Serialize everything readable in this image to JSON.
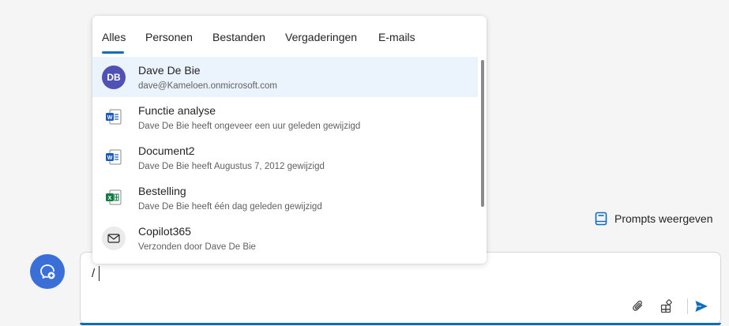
{
  "tabs": [
    {
      "label": "Alles"
    },
    {
      "label": "Personen"
    },
    {
      "label": "Bestanden"
    },
    {
      "label": "Vergaderingen"
    },
    {
      "label": "E-mails"
    }
  ],
  "results": [
    {
      "type": "person",
      "initials": "DB",
      "title": "Dave De Bie",
      "subtitle": "dave@Kameloen.onmicrosoft.com",
      "icon": "avatar"
    },
    {
      "type": "file",
      "title": "Functie analyse",
      "subtitle": "Dave De Bie heeft ongeveer een uur geleden gewijzigd",
      "icon": "word-icon"
    },
    {
      "type": "file",
      "title": "Document2",
      "subtitle": "Dave De Bie heeft Augustus 7, 2012 gewijzigd",
      "icon": "word-icon"
    },
    {
      "type": "file",
      "title": "Bestelling",
      "subtitle": "Dave De Bie heeft één dag geleden gewijzigd",
      "icon": "excel-icon"
    },
    {
      "type": "email",
      "title": "Copilot365",
      "subtitle": "Verzonden door Dave De Bie",
      "icon": "mail-icon"
    }
  ],
  "prompts": {
    "label": "Prompts weergeven",
    "icon": "prompts-book-icon"
  },
  "composer": {
    "value": "/"
  },
  "colors": {
    "accent": "#0f6cbd",
    "avatar": "#4f52b2",
    "word": "#185abd",
    "excel": "#107c41",
    "send": "#0f6cbd",
    "copilot": "#3a6fd8",
    "selected_row": "#ebf3fc"
  }
}
